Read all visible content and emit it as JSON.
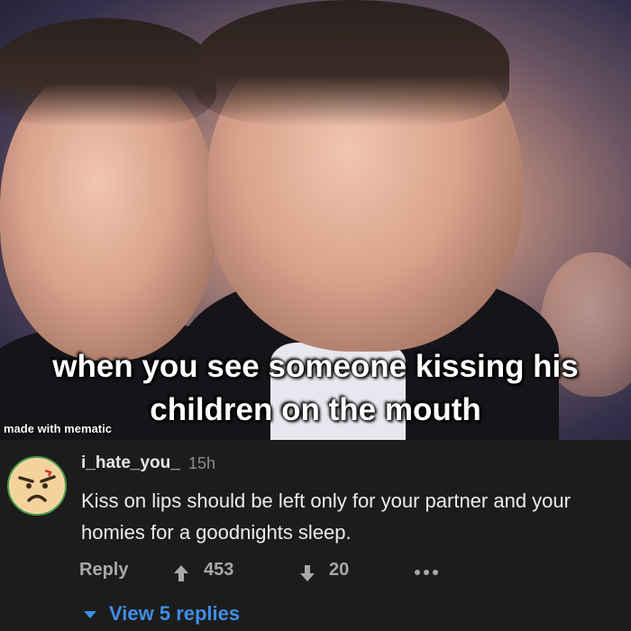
{
  "meme": {
    "caption_line1": "when you see someone kissing his",
    "caption_line2": "children on the mouth",
    "watermark": "made with mematic"
  },
  "comment": {
    "avatar_icon": "angry-face-avatar-icon",
    "username": "i_hate_you_",
    "time": "15h",
    "text": "Kiss on lips should be left only for your partner and your homies for a goodnights sleep.",
    "reply_label": "Reply",
    "upvotes": "453",
    "downvotes": "20",
    "view_replies": "View 5 replies"
  },
  "colors": {
    "background": "#1c1c1c",
    "link": "#3f8ee6",
    "muted": "#a9a9a9",
    "avatar_ring": "#4b9a4b"
  }
}
